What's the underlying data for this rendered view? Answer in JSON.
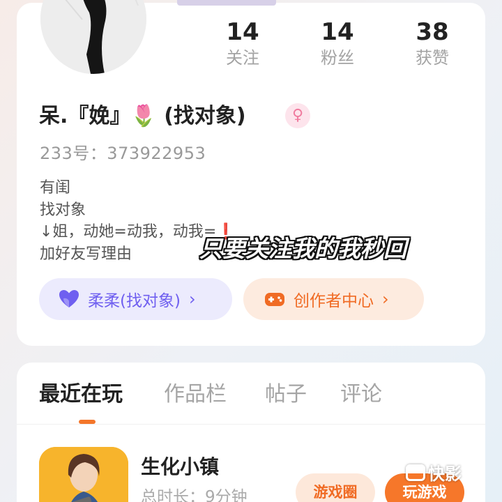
{
  "stats": [
    {
      "value": "14",
      "label": "关注"
    },
    {
      "value": "14",
      "label": "粉丝"
    },
    {
      "value": "38",
      "label": "获赞"
    }
  ],
  "profile": {
    "nickname": "呆.『娩』🌷 (找对象)",
    "gender_symbol": "♀",
    "uid_label": "233号：373922953",
    "bio": [
      "有闺",
      "找对象",
      "↓姐，动她=动我，动我=",
      "加好友写理由"
    ],
    "bio_heart": "❗"
  },
  "buttons": {
    "group_label": "柔柔(找对象)",
    "creator_label": "创作者中心",
    "chevron": "›"
  },
  "overlay": {
    "subtitle": "只要关注我的我秒回",
    "watermark": "快影"
  },
  "tabs": [
    {
      "label": "最近在玩",
      "active": true
    },
    {
      "label": "作品栏",
      "active": false
    },
    {
      "label": "帖子",
      "active": false
    },
    {
      "label": "评论",
      "active": false
    }
  ],
  "game": {
    "name": "生化小镇",
    "playtime": "总时长：9分钟",
    "circle_button": "游戏圈",
    "play_button": "玩游戏"
  },
  "colors": {
    "accent_orange": "#f6772a",
    "accent_purple": "#6f5ff0",
    "gender_pink": "#f07a9e"
  }
}
